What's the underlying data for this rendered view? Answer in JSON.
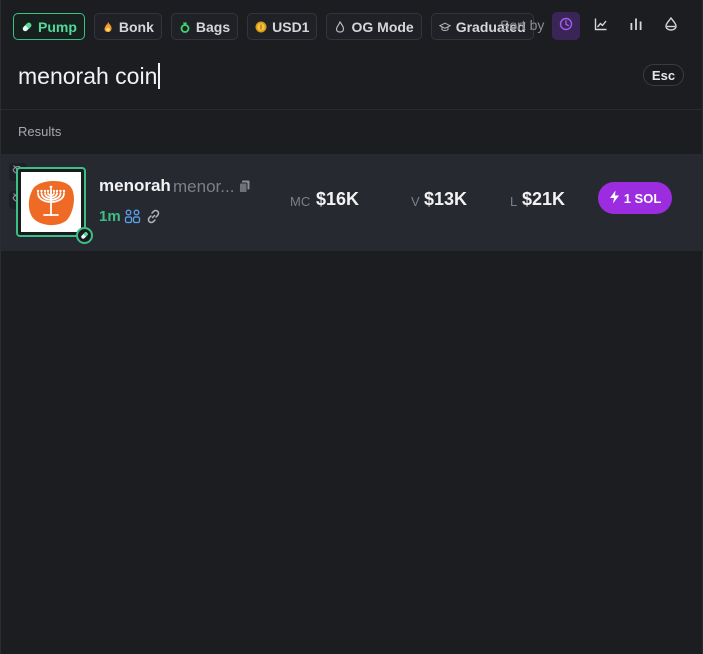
{
  "filters": [
    {
      "label": "Pump",
      "icon": "pill-icon",
      "active": true
    },
    {
      "label": "Bonk",
      "icon": "fire-icon",
      "active": false
    },
    {
      "label": "Bags",
      "icon": "bag-icon",
      "active": false
    },
    {
      "label": "USD1",
      "icon": "coin-icon",
      "active": false
    },
    {
      "label": "OG Mode",
      "icon": "flame-icon",
      "active": false
    },
    {
      "label": "Graduated",
      "icon": "graduation-cap-icon",
      "active": false
    }
  ],
  "sort": {
    "label": "Sort by",
    "options": [
      "clock-icon",
      "trend-line-icon",
      "bar-chart-icon",
      "liquidity-drop-icon"
    ],
    "active": "clock-icon"
  },
  "search": {
    "value": "menorah coin",
    "esc_label": "Esc"
  },
  "results": {
    "label": "Results",
    "items": [
      {
        "name": "menorah",
        "ticker": "menor...",
        "age": "1m",
        "mc_label": "MC",
        "mc_value": "$16K",
        "v_label": "V",
        "v_value": "$13K",
        "l_label": "L",
        "l_value": "$21K",
        "buy_label": "1 SOL"
      }
    ]
  },
  "colors": {
    "accent_green": "#3cbf85",
    "accent_purple": "#9b2ce0",
    "background": "#1c1d21",
    "row": "#272930"
  }
}
